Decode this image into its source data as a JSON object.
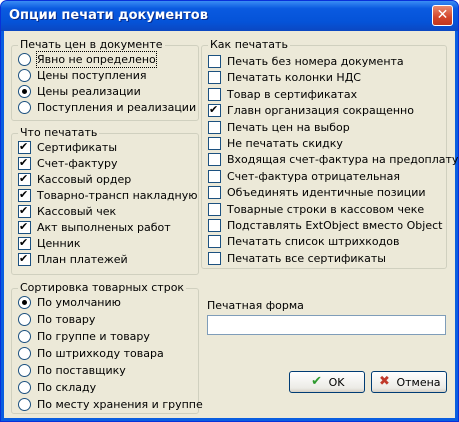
{
  "window": {
    "title": "Опции печати документов",
    "close_glyph": "✕"
  },
  "print_prices": {
    "legend": "Печать цен в документе",
    "options": [
      {
        "label": "Явно не определено",
        "selected": false
      },
      {
        "label": "Цены поступления",
        "selected": false
      },
      {
        "label": "Цены реализации",
        "selected": true
      },
      {
        "label": "Поступления и реализации",
        "selected": false
      }
    ]
  },
  "what_to_print": {
    "legend": "Что печатать",
    "items": [
      {
        "label": "Сертификаты",
        "checked": true
      },
      {
        "label": "Счет-фактуру",
        "checked": true
      },
      {
        "label": "Кассовый ордер",
        "checked": true
      },
      {
        "label": "Товарно-трансп накладную",
        "checked": true
      },
      {
        "label": "Кассовый чек",
        "checked": true
      },
      {
        "label": "Акт выполненых работ",
        "checked": true
      },
      {
        "label": "Ценник",
        "checked": true
      },
      {
        "label": "План платежей",
        "checked": true
      }
    ]
  },
  "sorting": {
    "legend": "Сортировка товарных строк",
    "options": [
      {
        "label": "По умолчанию",
        "selected": true
      },
      {
        "label": "По товару",
        "selected": false
      },
      {
        "label": "По группе и товару",
        "selected": false
      },
      {
        "label": "По штрихкоду товара",
        "selected": false
      },
      {
        "label": "По поставщику",
        "selected": false
      },
      {
        "label": "По складу",
        "selected": false
      },
      {
        "label": "По месту хранения и группе",
        "selected": false
      }
    ]
  },
  "how_to_print": {
    "legend": "Как печатать",
    "items": [
      {
        "label": "Печать без номера документа",
        "checked": false
      },
      {
        "label": "Печатать колонки НДС",
        "checked": false
      },
      {
        "label": "Товар в сертификатах",
        "checked": false
      },
      {
        "label": "Главн организация сокращенно",
        "checked": true
      },
      {
        "label": "Печать цен на выбор",
        "checked": false
      },
      {
        "label": "Не печатать скидку",
        "checked": false
      },
      {
        "label": "Входящая счет-фактура на предоплату",
        "checked": false
      },
      {
        "label": "Счет-фактура отрицательная",
        "checked": false
      },
      {
        "label": "Объединять идентичные позиции",
        "checked": false
      },
      {
        "label": "Товарные строки в кассовом чеке",
        "checked": false
      },
      {
        "label": "Подставлять ExtObject вместо Object",
        "checked": false
      },
      {
        "label": "Печатать список штрихкодов",
        "checked": false
      },
      {
        "label": "Печатать все сертификаты",
        "checked": false
      }
    ]
  },
  "print_form": {
    "label": "Печатная форма",
    "value": ""
  },
  "buttons": {
    "ok": "OK",
    "cancel": "Отмена"
  },
  "colors": {
    "ok_icon": "#2e9a2e",
    "cancel_icon": "#c0392b"
  }
}
